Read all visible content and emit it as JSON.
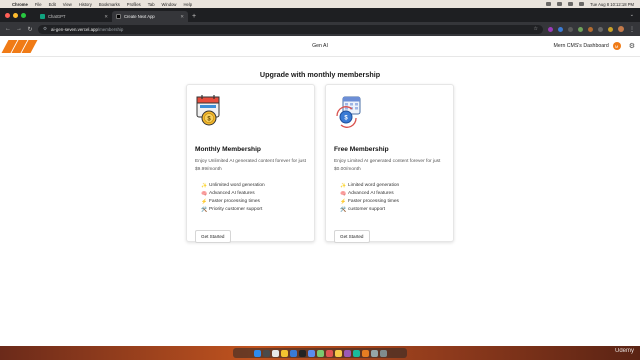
{
  "menubar": {
    "app_name": "Chrome",
    "items": [
      "File",
      "Edit",
      "View",
      "History",
      "Bookmarks",
      "Profiles",
      "Tab",
      "Window",
      "Help"
    ],
    "clock": "Tue Aug 8  10:12:18 PM"
  },
  "browser": {
    "tabs": [
      {
        "title": "ChatGPT",
        "favicon": "chatgpt-icon"
      },
      {
        "title": "Create Next App",
        "favicon": "nextjs-icon"
      }
    ],
    "url_host": "ai-gen-seven.vercel.app",
    "url_path": "/membership"
  },
  "header": {
    "app_title": "Gen AI",
    "dashboard_link": "Mern CMS's Dashboard",
    "avatar_initial": "M",
    "brand_color": "#f07b16"
  },
  "main": {
    "heading": "Upgrade with monthly membership",
    "plans": [
      {
        "title": "Monthly Membership",
        "description": "Enjoy Unlimited AI generated content forever for just $9.99/month",
        "features": [
          {
            "icon": "✨",
            "text": "Unlimited word generation"
          },
          {
            "icon": "🧠",
            "text": "Advanced AI features"
          },
          {
            "icon": "⚡",
            "text": "Faster processing times"
          },
          {
            "icon": "🛠️",
            "text": "Priority customer support"
          }
        ],
        "cta": "Get Started"
      },
      {
        "title": "Free Membership",
        "description": "Enjoy Limited AI generated content forever for just $0.00/month",
        "features": [
          {
            "icon": "✨",
            "text": "Limited word generation"
          },
          {
            "icon": "🧠",
            "text": "Advanced AI features"
          },
          {
            "icon": "⚡",
            "text": "Faster processing times"
          },
          {
            "icon": "🛠️",
            "text": "customer support"
          }
        ],
        "cta": "Get Started"
      }
    ]
  },
  "watermark": "Udemy"
}
